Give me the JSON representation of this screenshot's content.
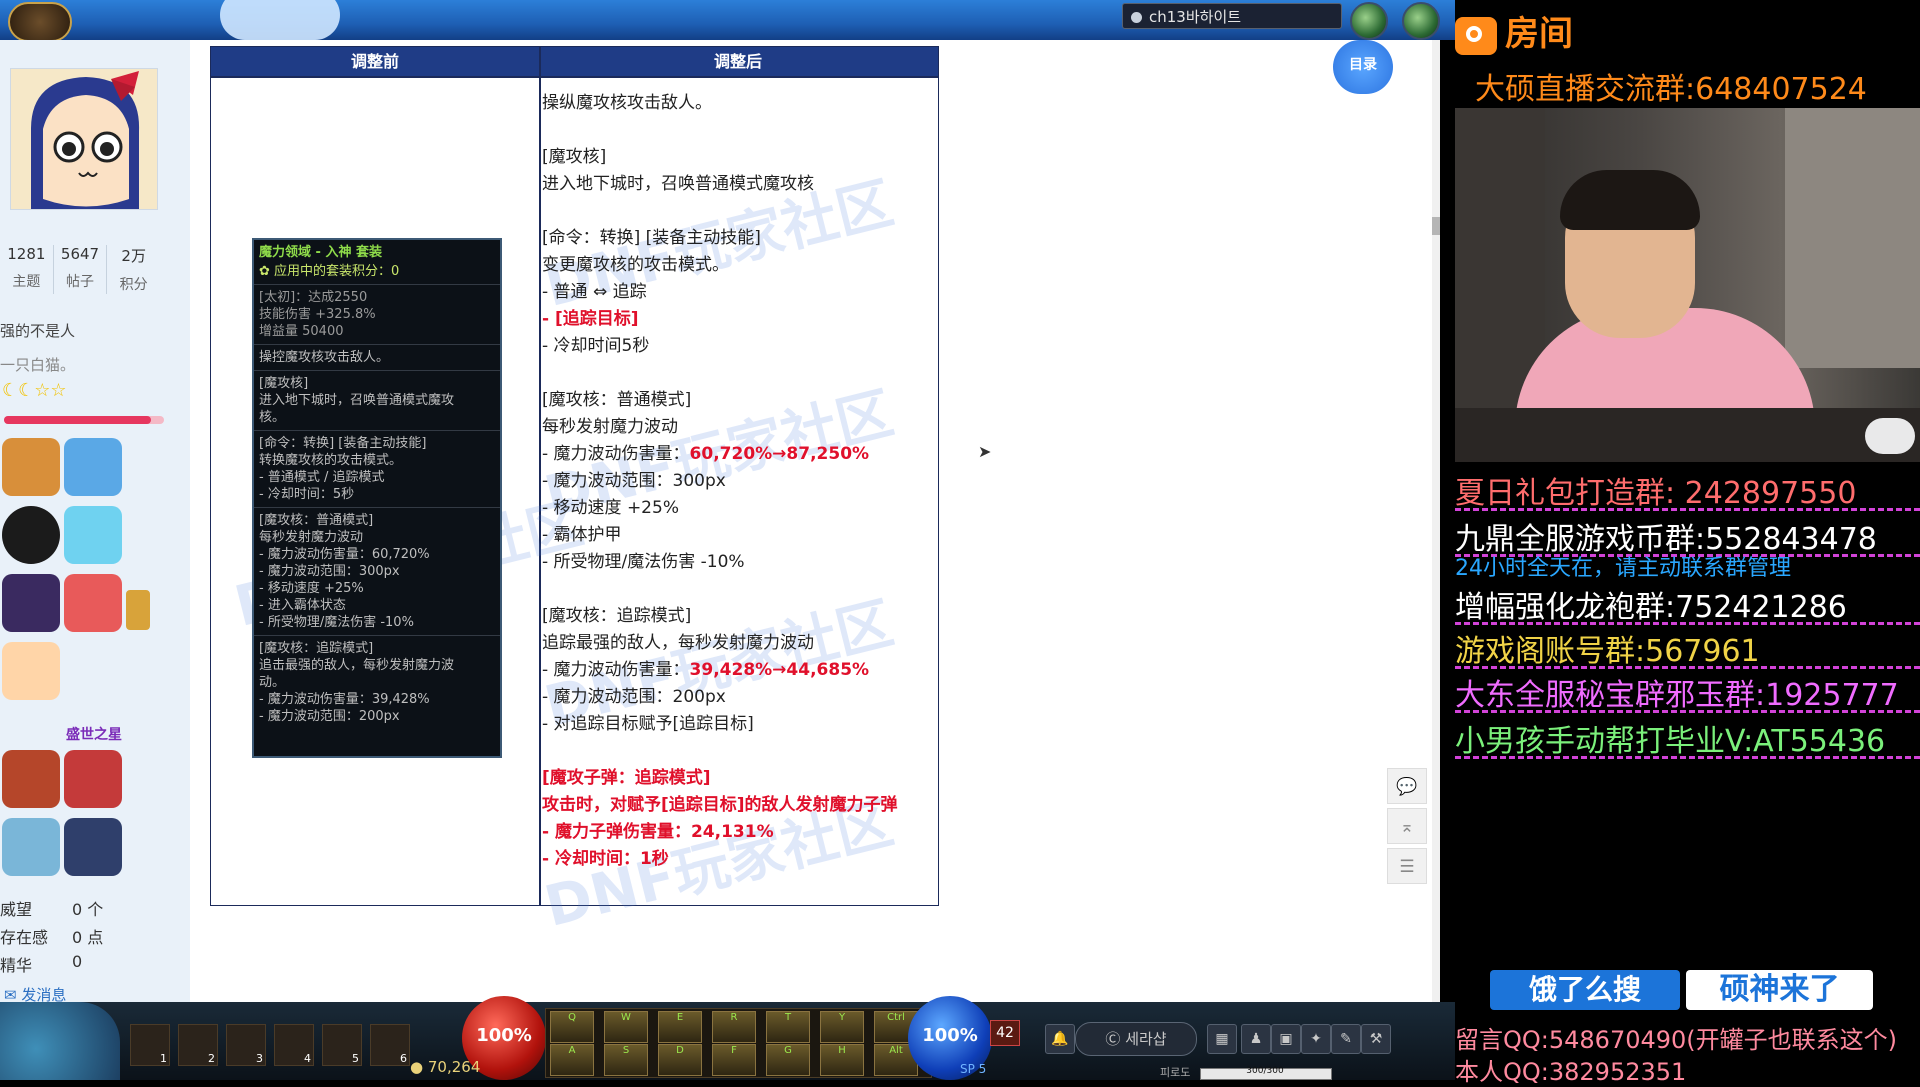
{
  "game": {
    "server_label": "ch13바하이트",
    "hp_percent_label": "100%",
    "mp_percent_label": "100%",
    "level_badge": "42",
    "gold": "70,264",
    "sp_label": "SP 5",
    "search_label": "세라샵",
    "fatigue": "300/300",
    "fatigue_label": "피로도",
    "hotkeys": [
      "1",
      "2",
      "3",
      "4",
      "5",
      "6"
    ],
    "skill_keys": [
      "Q",
      "W",
      "E",
      "R",
      "T",
      "Y",
      "Ctrl",
      "A",
      "S",
      "D",
      "F",
      "G",
      "H",
      "Alt"
    ]
  },
  "profile": {
    "stats": [
      {
        "value": "1281",
        "label": "主题"
      },
      {
        "value": "5647",
        "label": "帖子"
      },
      {
        "value": "2万",
        "label": "积分"
      }
    ],
    "title": "强的不是人",
    "subtitle": "一只白猫。",
    "medal_label": "盛世之星",
    "kv": [
      {
        "key": "威望",
        "value": "0 个"
      },
      {
        "key": "存在感",
        "value": "0 点"
      },
      {
        "key": "精华",
        "value": "0"
      }
    ],
    "message_link": "发消息"
  },
  "table": {
    "header_before": "调整前",
    "header_after": "调整后",
    "after_lines": [
      {
        "text": "操纵魔攻核攻击敌人。",
        "style": "normal"
      },
      {
        "text": "",
        "style": "normal"
      },
      {
        "text": "[魔攻核]",
        "style": "normal"
      },
      {
        "text": "进入地下城时，召唤普通模式魔攻核",
        "style": "normal"
      },
      {
        "text": "",
        "style": "normal"
      },
      {
        "text": "[命令：转换] [装备主动技能]",
        "style": "normal"
      },
      {
        "text": "变更魔攻核的攻击模式。",
        "style": "normal"
      },
      {
        "text": "- 普通 ⇔ 追踪",
        "style": "normal"
      },
      {
        "text": "- [追踪目标]",
        "style": "red"
      },
      {
        "text": "- 冷却时间5秒",
        "style": "normal"
      },
      {
        "text": "",
        "style": "normal"
      },
      {
        "text": "[魔攻核：普通模式]",
        "style": "normal"
      },
      {
        "text": "每秒发射魔力波动",
        "style": "normal"
      },
      {
        "text": "- 魔力波动伤害量：",
        "value": "60,720%→87,250%",
        "style": "mixed"
      },
      {
        "text": "- 魔力波动范围：300px",
        "style": "normal"
      },
      {
        "text": "- 移动速度 +25%",
        "style": "normal"
      },
      {
        "text": "- 霸体护甲",
        "style": "normal"
      },
      {
        "text": "- 所受物理/魔法伤害 -10%",
        "style": "normal"
      },
      {
        "text": "",
        "style": "normal"
      },
      {
        "text": "[魔攻核：追踪模式]",
        "style": "normal"
      },
      {
        "text": "追踪最强的敌人，每秒发射魔力波动",
        "style": "normal"
      },
      {
        "text": "- 魔力波动伤害量：",
        "value": "39,428%→44,685%",
        "style": "mixed"
      },
      {
        "text": "- 魔力波动范围：200px",
        "style": "normal"
      },
      {
        "text": "- 对追踪目标赋予[追踪目标]",
        "style": "normal"
      },
      {
        "text": "",
        "style": "normal"
      },
      {
        "text": "[魔攻子弹：追踪模式]",
        "style": "red"
      },
      {
        "text": "攻击时，对赋予[追踪目标]的敌人发射魔力子弹",
        "style": "red"
      },
      {
        "text": "- 魔力子弹伤害量：24,131%",
        "style": "red"
      },
      {
        "text": "- 冷却时间：1秒",
        "style": "red"
      }
    ],
    "watermark": "DNF玩家社区"
  },
  "tooltip": {
    "title": "魔力领域 - 入神 套装",
    "set_points": "应用中的套装积分：0",
    "lines": [
      "[太初]：达成2550",
      "技能伤害 +325.8%",
      "增益量 50400",
      "操控魔攻核攻击敌人。",
      "[魔攻核]",
      "进入地下城时，召唤普通模式魔攻",
      "核。",
      "[命令：转换] [装备主动技能]",
      "转换魔攻核的攻击模式。",
      "- 普通模式 / 追踪模式",
      "- 冷却时间：5秒",
      "[魔攻核：普通模式]",
      "每秒发射魔力波动",
      "- 魔力波动伤害量：60,720%",
      "- 魔力波动范围：300px",
      "- 移动速度 +25%",
      "- 进入霸体状态",
      "- 所受物理/魔法伤害 -10%",
      "[魔攻核：追踪模式]",
      "追击最强的敌人，每秒发射魔力波",
      "动。",
      "- 魔力波动伤害量：39,428%",
      "- 魔力波动范围：200px"
    ]
  },
  "tools": {
    "toc_label": "目录"
  },
  "overlay": {
    "logo": "房间",
    "group": "大硕直播交流群:648407524",
    "ads": [
      {
        "text": "夏日礼包打造群: 242897550",
        "color": "#ff6d6d"
      },
      {
        "text": "九鼎全服游戏币群:552843478",
        "color": "#ffffff"
      },
      {
        "text": "增幅强化龙袍群:752421286",
        "color": "#ffffff"
      },
      {
        "text": "游戏阁账号群:567961",
        "color": "#f0d347"
      },
      {
        "text": "大东全服秘宝辟邪玉群:1925777",
        "color": "#f06cff"
      },
      {
        "text": "小男孩手动帮打毕业V:AT55436",
        "color": "#7bf07b"
      }
    ],
    "sub": "24小时全天在，请主动联系群管理",
    "search_a": "饿了么搜",
    "search_b": "硕神来了",
    "qq1": "留言QQ:548670490(开罐子也联系这个)",
    "qq2": "本人QQ:382952351"
  }
}
